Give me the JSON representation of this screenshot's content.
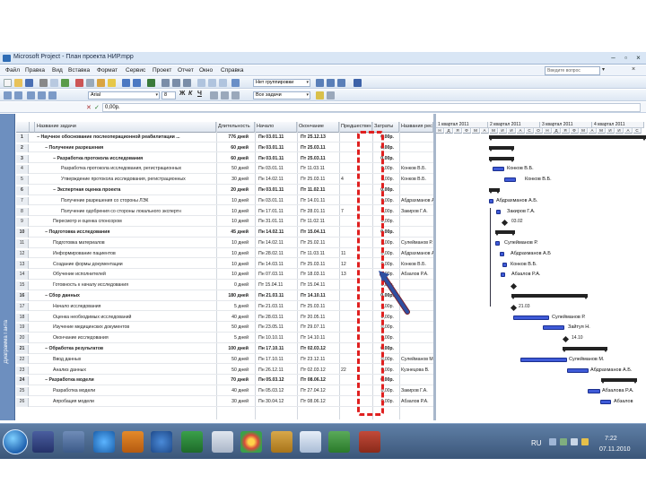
{
  "window": {
    "title": "Microsoft Project - План проекта НИР.mpp",
    "controls": [
      "–",
      "▫",
      "×"
    ]
  },
  "menu": {
    "items": [
      "Файл",
      "Правка",
      "Вид",
      "Вставка",
      "Формат",
      "Сервис",
      "Проект",
      "Отчет",
      "Окно",
      "Справка"
    ],
    "help_placeholder": "Введите вопрос"
  },
  "toolbar": {
    "group_combo": "Нет группировки",
    "font_name": "Arial",
    "font_size": "8",
    "bold": "Ж",
    "italic": "К",
    "underline": "Ч",
    "filter_combo": "Все задачи"
  },
  "entry_bar": {
    "cancel": "✕",
    "confirm": "✓",
    "value": "0,00р."
  },
  "view_bar": {
    "label": "Диаграмма Ганта"
  },
  "table": {
    "headers": {
      "name": "Название задачи",
      "duration": "Длительность",
      "start": "Начало",
      "finish": "Окончание",
      "predecessors": "Предшественники",
      "cost": "Затраты",
      "resources": "Названия ресурсов"
    },
    "rows": [
      {
        "id": "1",
        "name": "− Научное обоснование послеоперационной реабилитации ...",
        "duration": "776 дней",
        "start": "Пн 03.01.11",
        "finish": "Пт 25.12.13",
        "pred": "",
        "cost": "0,00р.",
        "res": "",
        "summary": true,
        "indent": 0
      },
      {
        "id": "2",
        "name": "− Получение разрешения",
        "duration": "60 дней",
        "start": "Пн 03.01.11",
        "finish": "Пт 25.03.11",
        "pred": "",
        "cost": "0,00р.",
        "res": "",
        "summary": true,
        "indent": 1
      },
      {
        "id": "3",
        "name": "− Разработка протокола исследования",
        "duration": "60 дней",
        "start": "Пн 03.01.11",
        "finish": "Пт 25.03.11",
        "pred": "",
        "cost": "0,00р.",
        "res": "",
        "summary": true,
        "indent": 2
      },
      {
        "id": "4",
        "name": "Разработка протокола исследования, регистрационных",
        "duration": "50 дней",
        "start": "Пн 03.01.11",
        "finish": "Пт 11.03.11",
        "pred": "",
        "cost": "0,00р.",
        "res": "Конков В.Б.",
        "summary": false,
        "indent": 3
      },
      {
        "id": "5",
        "name": "Утверждение протокола исследования, регистрационных",
        "duration": "30 дней",
        "start": "Пн 14.02.11",
        "finish": "Пт 25.03.11",
        "pred": "4",
        "cost": "0,00р.",
        "res": "Конков В.Б.",
        "summary": false,
        "indent": 3
      },
      {
        "id": "6",
        "name": "− Экспертная оценка проекта",
        "duration": "20 дней",
        "start": "Пн 03.01.11",
        "finish": "Пт 11.02.11",
        "pred": "",
        "cost": "0,00р.",
        "res": "",
        "summary": true,
        "indent": 2
      },
      {
        "id": "7",
        "name": "Получение разрешения со стороны ЛЭК",
        "duration": "10 дней",
        "start": "Пн 03.01.11",
        "finish": "Пт 14.01.11",
        "pred": "",
        "cost": "0,00р.",
        "res": "Абдрахманов А.Б.",
        "summary": false,
        "indent": 3
      },
      {
        "id": "8",
        "name": "Получение одобрения со стороны локального экспертн",
        "duration": "10 дней",
        "start": "Пн 17.01.11",
        "finish": "Пт 28.01.11",
        "pred": "7",
        "cost": "0,00р.",
        "res": "Закиров Г.А.",
        "summary": false,
        "indent": 3
      },
      {
        "id": "9",
        "name": "Пересмотр и оценка спонсором",
        "duration": "10 дней",
        "start": "Пн 31.01.11",
        "finish": "Пт 11.02.11",
        "pred": "",
        "cost": "0,00р.",
        "res": "",
        "summary": false,
        "indent": 2
      },
      {
        "id": "10",
        "name": "− Подготовка исследования",
        "duration": "45 дней",
        "start": "Пн 14.02.11",
        "finish": "Пт 15.04.11",
        "pred": "",
        "cost": "0,00р.",
        "res": "",
        "summary": true,
        "indent": 1
      },
      {
        "id": "11",
        "name": "Подготовка материалов",
        "duration": "10 дней",
        "start": "Пн 14.02.11",
        "finish": "Пт 25.02.11",
        "pred": "",
        "cost": "0,00р.",
        "res": "Сулейманов Р.",
        "summary": false,
        "indent": 2
      },
      {
        "id": "12",
        "name": "Информирование пациентов",
        "duration": "10 дней",
        "start": "Пн 28.02.11",
        "finish": "Пт 11.03.11",
        "pred": "11",
        "cost": "0,00р.",
        "res": "Абдрахманов А.Б.",
        "summary": false,
        "indent": 2
      },
      {
        "id": "13",
        "name": "Создание формы документации",
        "duration": "10 дней",
        "start": "Пн 14.03.11",
        "finish": "Пт 25.03.11",
        "pred": "12",
        "cost": "0,00р.",
        "res": "Конков В.Б.",
        "summary": false,
        "indent": 2
      },
      {
        "id": "14",
        "name": "Обучение исполнителей",
        "duration": "10 дней",
        "start": "Пн 07.03.11",
        "finish": "Пт 18.03.11",
        "pred": "13",
        "cost": "0,00р.",
        "res": "Абзалов Р.А.",
        "summary": false,
        "indent": 2
      },
      {
        "id": "15",
        "name": "Готовность к началу исследования",
        "duration": "0 дней",
        "start": "Пт 15.04.11",
        "finish": "Пт 15.04.11",
        "pred": "",
        "cost": "0,00р.",
        "res": "",
        "summary": false,
        "indent": 2
      },
      {
        "id": "16",
        "name": "− Сбор данных",
        "duration": "180 дней",
        "start": "Пн 21.03.11",
        "finish": "Пт 14.10.11",
        "pred": "",
        "cost": "0,00р.",
        "res": "",
        "summary": true,
        "indent": 1
      },
      {
        "id": "17",
        "name": "Начало исследования",
        "duration": "5 дней",
        "start": "Пн 21.03.11",
        "finish": "Пт 25.03.11",
        "pred": "",
        "cost": "0,00р.",
        "res": "",
        "summary": false,
        "indent": 2
      },
      {
        "id": "18",
        "name": "Оценка необходимых исследований",
        "duration": "40 дней",
        "start": "Пн 28.03.11",
        "finish": "Пт 20.05.11",
        "pred": "",
        "cost": "0,00р.",
        "res": "",
        "summary": false,
        "indent": 2
      },
      {
        "id": "19",
        "name": "Изучение медицинских документов",
        "duration": "50 дней",
        "start": "Пн 23.05.11",
        "finish": "Пт 29.07.11",
        "pred": "",
        "cost": "0,00р.",
        "res": "",
        "summary": false,
        "indent": 2
      },
      {
        "id": "20",
        "name": "Окончание исследования",
        "duration": "5 дней",
        "start": "Пн 10.10.11",
        "finish": "Пт 14.10.11",
        "pred": "",
        "cost": "0,00р.",
        "res": "",
        "summary": false,
        "indent": 2
      },
      {
        "id": "21",
        "name": "− Обработка результатов",
        "duration": "100 дней",
        "start": "Пн 17.10.11",
        "finish": "Пт 02.03.12",
        "pred": "",
        "cost": "0,00р.",
        "res": "",
        "summary": true,
        "indent": 1
      },
      {
        "id": "22",
        "name": "Ввод данных",
        "duration": "50 дней",
        "start": "Пн 17.10.11",
        "finish": "Пт 23.12.11",
        "pred": "",
        "cost": "0,00р.",
        "res": "Сулейманов М.",
        "summary": false,
        "indent": 2
      },
      {
        "id": "23",
        "name": "Анализ данных",
        "duration": "50 дней",
        "start": "Пн 26.12.11",
        "finish": "Пт 02.03.12",
        "pred": "22",
        "cost": "0,00р.",
        "res": "Кузнецова В.",
        "summary": false,
        "indent": 2
      },
      {
        "id": "24",
        "name": "− Разработка модели",
        "duration": "70 дней",
        "start": "Пн 05.03.12",
        "finish": "Пт 08.06.12",
        "pred": "",
        "cost": "0,00р.",
        "res": "",
        "summary": true,
        "indent": 1
      },
      {
        "id": "25",
        "name": "Разработка модели",
        "duration": "40 дней",
        "start": "Пн 05.03.12",
        "finish": "Пт 27.04.12",
        "pred": "",
        "cost": "0,00р.",
        "res": "Закиров Г.А.",
        "summary": false,
        "indent": 2
      },
      {
        "id": "26",
        "name": "Апробация модели",
        "duration": "30 дней",
        "start": "Пн 30.04.12",
        "finish": "Пт 08.06.12",
        "pred": "",
        "cost": "0,00р.",
        "res": "Абзалов Р.А.",
        "summary": false,
        "indent": 2
      }
    ]
  },
  "gantt": {
    "quarters": [
      "1 квартал 2011",
      "2 квартал 2011",
      "3 квартал 2011",
      "4 квартал 2011"
    ],
    "days": [
      "Н",
      "Д",
      "Я",
      "Ф",
      "М",
      "А",
      "М",
      "И",
      "И",
      "А",
      "С",
      "О",
      "Н",
      "Д",
      "Я",
      "Ф",
      "М",
      "А",
      "М",
      "И",
      "И",
      "А",
      "С"
    ],
    "labels": {
      "r4": "Конков В.Б.",
      "r5": "Конков В.Б.",
      "r7": "Абдрахманов А.Б.",
      "r8": "Закиров Г.А.",
      "r9": "03.02",
      "r11": "Сулейманов Р.",
      "r12": "Абдрахманов А.Б",
      "r13": "Конков В.Б.",
      "r14": "Абзалов Р.А.",
      "r17": "21.03",
      "r18": "Сулейманов Р.",
      "r19": "Зайтуя Н.",
      "r20": "14.10",
      "r22": "Сулейманов М.",
      "r23": "Абдрахманов А.Б.",
      "r25": "Абзалова Р.А.",
      "r26": "Абзалов"
    }
  },
  "taskbar": {
    "lang": "RU",
    "time": "7:22",
    "date": "07.11.2010"
  },
  "colors": {
    "highlight": "#e02020",
    "task_bar": "#3f5bd8",
    "arrow": "#2f4fa0"
  }
}
